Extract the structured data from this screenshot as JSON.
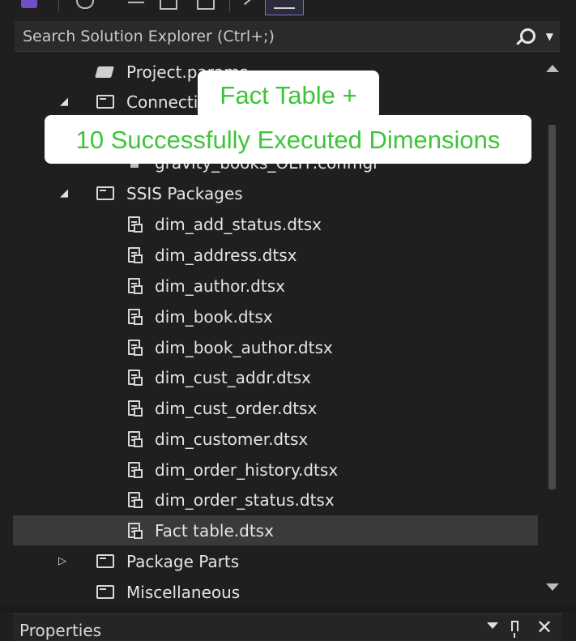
{
  "search": {
    "placeholder": "Search Solution Explorer (Ctrl+;)"
  },
  "tree": {
    "items": [
      {
        "label": "Project.params"
      },
      {
        "label": "Connection Managers"
      },
      {
        "label": "gravity_books_OLTP.conmgr"
      },
      {
        "label": "SSIS Packages"
      },
      {
        "label": "dim_add_status.dtsx"
      },
      {
        "label": "dim_address.dtsx"
      },
      {
        "label": "dim_author.dtsx"
      },
      {
        "label": "dim_book.dtsx"
      },
      {
        "label": "dim_book_author.dtsx"
      },
      {
        "label": "dim_cust_addr.dtsx"
      },
      {
        "label": "dim_cust_order.dtsx"
      },
      {
        "label": "dim_customer.dtsx"
      },
      {
        "label": "dim_order_history.dtsx"
      },
      {
        "label": "dim_order_status.dtsx"
      },
      {
        "label": "Fact table.dtsx"
      },
      {
        "label": "Package Parts"
      },
      {
        "label": "Miscellaneous"
      }
    ]
  },
  "overlay": {
    "line1": "Fact Table +",
    "line2": "10 Successfully Executed Dimensions"
  },
  "properties": {
    "title": "Properties",
    "close": "✕"
  },
  "colors": {
    "overlay_text": "#3fc43a",
    "background": "#1f1f1f",
    "selected_row": "#3a3a3a"
  }
}
